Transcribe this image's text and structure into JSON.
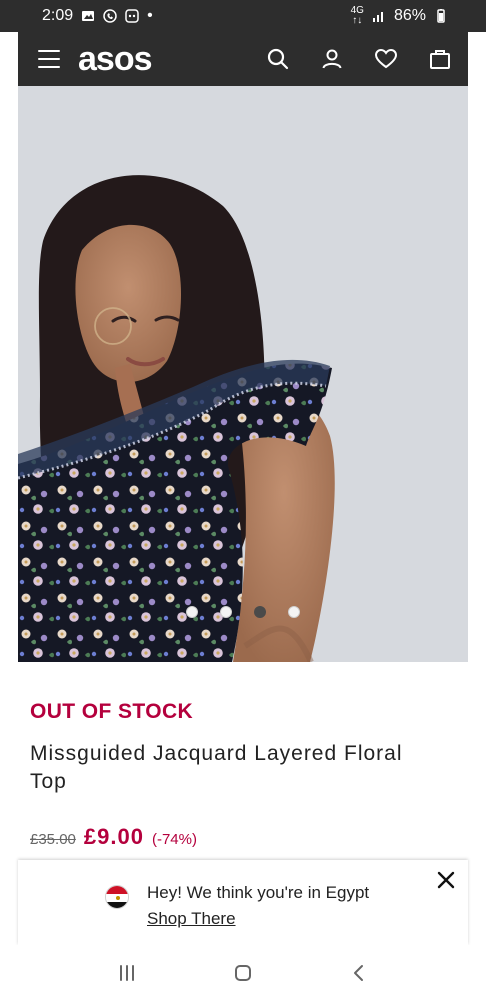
{
  "status_bar": {
    "time": "2:09",
    "left_icons": [
      "gallery-icon",
      "phone-icon",
      "message-icon"
    ],
    "dot": "•",
    "network_lines": [
      "4G",
      "↑↓"
    ],
    "battery": "86%"
  },
  "header": {
    "logo": "asos",
    "icons": [
      "menu-icon",
      "search-icon",
      "account-icon",
      "heart-icon",
      "bag-icon"
    ]
  },
  "carousel": {
    "total": 4,
    "active_index": 2
  },
  "product": {
    "stock_status": "OUT OF STOCK",
    "title": "Missguided Jacquard Layered Floral Top",
    "old_price": "£35.00",
    "new_price": "£9.00",
    "discount": "(-74%)"
  },
  "banner": {
    "message": "Hey! We think you're in Egypt",
    "link": "Shop There"
  },
  "nav": {
    "icons": [
      "recent-apps-icon",
      "home-icon",
      "back-icon"
    ]
  },
  "colors": {
    "header_bg": "#2d2d2d",
    "accent": "#b4003d"
  }
}
